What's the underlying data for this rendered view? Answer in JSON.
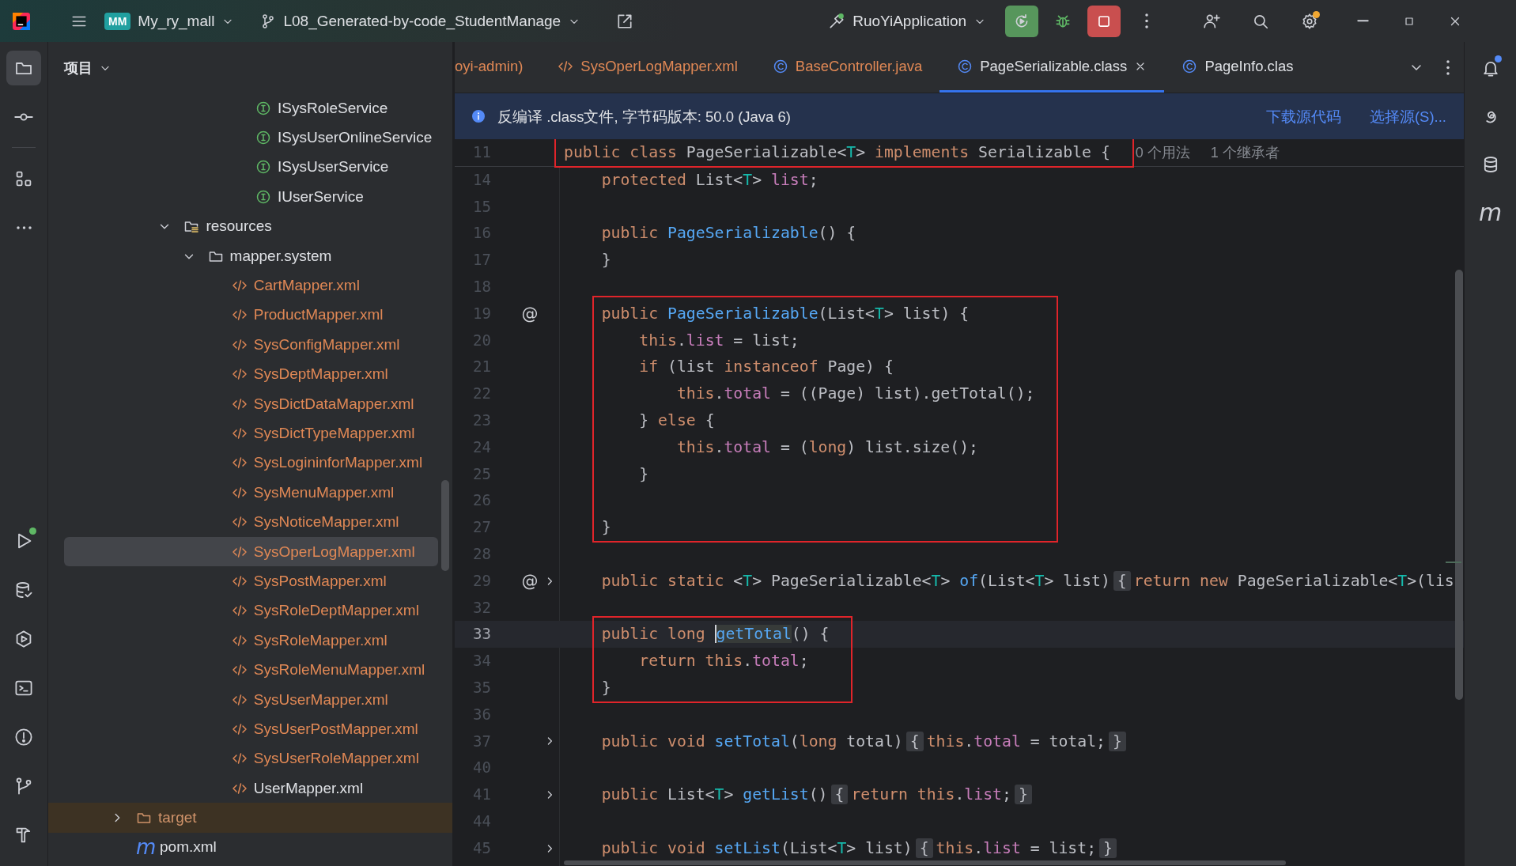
{
  "toolbar": {
    "project_badge": "MM",
    "project": "My_ry_mall",
    "branch": "L08_Generated-by-code_StudentManage",
    "run_configuration": "RuoYiApplication",
    "settings_badge": true
  },
  "left_strip": {
    "top": [
      {
        "kind": "project",
        "selected": true,
        "badge": false
      },
      {
        "kind": "commit",
        "selected": false,
        "badge": false
      },
      {
        "kind": "structure",
        "selected": false,
        "badge": false
      },
      {
        "kind": "more",
        "selected": false,
        "badge": false
      }
    ],
    "bottom": [
      {
        "kind": "run",
        "selected": false,
        "badge": true
      },
      {
        "kind": "database",
        "selected": false,
        "badge": false
      },
      {
        "kind": "services",
        "selected": false,
        "badge": false
      },
      {
        "kind": "terminal",
        "selected": false,
        "badge": false
      },
      {
        "kind": "problems",
        "selected": false,
        "badge": false
      },
      {
        "kind": "git",
        "selected": false,
        "badge": false
      },
      {
        "kind": "build",
        "selected": false,
        "badge": false
      }
    ]
  },
  "project_panel": {
    "title": "项目",
    "tree": [
      {
        "children": [
          {
            "children": [
              {
                "children": [
                  {
                    "children": [
                      {
                        "children": [
                          {
                            "label": "ISysRoleService",
                            "kind": "interface",
                            "color": "#dfe1e5",
                            "selected": false
                          },
                          {
                            "label": "ISysUserOnlineService",
                            "kind": "interface",
                            "color": "#dfe1e5",
                            "selected": false
                          },
                          {
                            "label": "ISysUserService",
                            "kind": "interface",
                            "color": "#dfe1e5",
                            "selected": false
                          },
                          {
                            "label": "IUserService",
                            "kind": "interface",
                            "color": "#dfe1e5",
                            "selected": false
                          }
                        ]
                      }
                    ]
                  }
                ]
              },
              {
                "label": "resources",
                "kind": "resource-folder",
                "color": "#dfe1e5",
                "selected": false,
                "expanded": true,
                "children": [
                  {
                    "label": "mapper.system",
                    "kind": "folder",
                    "color": "#dfe1e5",
                    "selected": false,
                    "expanded": true,
                    "children": [
                      {
                        "label": "CartMapper.xml",
                        "kind": "xml",
                        "color": "#e08855",
                        "selected": false
                      },
                      {
                        "label": "ProductMapper.xml",
                        "kind": "xml",
                        "color": "#e08855",
                        "selected": false
                      },
                      {
                        "label": "SysConfigMapper.xml",
                        "kind": "xml",
                        "color": "#e08855",
                        "selected": false
                      },
                      {
                        "label": "SysDeptMapper.xml",
                        "kind": "xml",
                        "color": "#e08855",
                        "selected": false
                      },
                      {
                        "label": "SysDictDataMapper.xml",
                        "kind": "xml",
                        "color": "#e08855",
                        "selected": false
                      },
                      {
                        "label": "SysDictTypeMapper.xml",
                        "kind": "xml",
                        "color": "#e08855",
                        "selected": false
                      },
                      {
                        "label": "SysLogininforMapper.xml",
                        "kind": "xml",
                        "color": "#e08855",
                        "selected": false
                      },
                      {
                        "label": "SysMenuMapper.xml",
                        "kind": "xml",
                        "color": "#e08855",
                        "selected": false
                      },
                      {
                        "label": "SysNoticeMapper.xml",
                        "kind": "xml",
                        "color": "#e08855",
                        "selected": false
                      },
                      {
                        "label": "SysOperLogMapper.xml",
                        "kind": "xml",
                        "color": "#e08855",
                        "selected": true
                      },
                      {
                        "label": "SysPostMapper.xml",
                        "kind": "xml",
                        "color": "#e08855",
                        "selected": false
                      },
                      {
                        "label": "SysRoleDeptMapper.xml",
                        "kind": "xml",
                        "color": "#e08855",
                        "selected": false
                      },
                      {
                        "label": "SysRoleMapper.xml",
                        "kind": "xml",
                        "color": "#e08855",
                        "selected": false
                      },
                      {
                        "label": "SysRoleMenuMapper.xml",
                        "kind": "xml",
                        "color": "#e08855",
                        "selected": false
                      },
                      {
                        "label": "SysUserMapper.xml",
                        "kind": "xml",
                        "color": "#e08855",
                        "selected": false
                      },
                      {
                        "label": "SysUserPostMapper.xml",
                        "kind": "xml",
                        "color": "#e08855",
                        "selected": false
                      },
                      {
                        "label": "SysUserRoleMapper.xml",
                        "kind": "xml",
                        "color": "#e08855",
                        "selected": false
                      },
                      {
                        "label": "UserMapper.xml",
                        "kind": "xml",
                        "color": "#dfe1e5",
                        "selected": false
                      }
                    ]
                  }
                ]
              }
            ]
          }
        ]
      },
      {
        "label": "target",
        "kind": "excluded-folder",
        "color": "#d0936a",
        "selected": false,
        "expanded": false
      },
      {
        "label": "pom.xml",
        "kind": "maven",
        "glyph": "m",
        "color": "#dfe1e5",
        "selected": false
      }
    ]
  },
  "editor": {
    "tabs": [
      {
        "label": "oyi-admin)",
        "kind": "none",
        "color": "#e08855",
        "selected": false
      },
      {
        "label": "SysOperLogMapper.xml",
        "kind": "xml",
        "color": "#e08855",
        "selected": false
      },
      {
        "label": "BaseController.java",
        "kind": "class",
        "color": "#e08855",
        "selected": false
      },
      {
        "label": "PageSerializable.class",
        "kind": "class",
        "color": "#dfe1e5",
        "selected": true
      },
      {
        "label": "PageInfo.clas",
        "kind": "class",
        "color": "#dfe1e5",
        "selected": false
      }
    ],
    "banner": {
      "message": "反编译 .class文件, 字节码版本: 50.0 (Java 6)",
      "links": [
        "下载源代码",
        "选择源(S)..."
      ]
    },
    "blocks": [
      {
        "kind": "sticky",
        "boxed": true,
        "lines": [
          {
            "number": "11",
            "folded": false,
            "current": false,
            "hints": [
              "0 个用法",
              "1 个继承者"
            ],
            "tokens": [
              {
                "kind": "kw",
                "text": "public class "
              },
              {
                "kind": "plain",
                "text": "PageSerializable<"
              },
              {
                "kind": "tparam",
                "text": "T"
              },
              {
                "kind": "plain",
                "text": "> "
              },
              {
                "kind": "kw",
                "text": "implements "
              },
              {
                "kind": "plain",
                "text": "Serializable {"
              }
            ]
          }
        ]
      },
      {
        "kind": "code",
        "boxed": false,
        "lines": [
          {
            "number": "14",
            "folded": false,
            "current": false,
            "tokens": [
              {
                "kind": "kw",
                "text": "    protected "
              },
              {
                "kind": "plain",
                "text": "List<"
              },
              {
                "kind": "tparam",
                "text": "T"
              },
              {
                "kind": "plain",
                "text": "> "
              },
              {
                "kind": "field",
                "text": "list"
              },
              {
                "kind": "plain",
                "text": ";"
              }
            ]
          },
          {
            "number": "15",
            "folded": false,
            "current": false
          },
          {
            "number": "16",
            "folded": false,
            "current": false,
            "tokens": [
              {
                "kind": "kw",
                "text": "    public "
              },
              {
                "kind": "fn",
                "text": "PageSerializable"
              },
              {
                "kind": "plain",
                "text": "() {"
              }
            ]
          },
          {
            "number": "17",
            "folded": false,
            "current": false,
            "tokens": [
              {
                "kind": "plain",
                "text": "    }"
              }
            ]
          },
          {
            "number": "18",
            "folded": false,
            "current": false
          }
        ]
      },
      {
        "kind": "code",
        "boxed": true,
        "lines": [
          {
            "number": "19",
            "gutter": "@",
            "folded": false,
            "current": false,
            "tokens": [
              {
                "kind": "kw",
                "text": "    public "
              },
              {
                "kind": "fn",
                "text": "PageSerializable"
              },
              {
                "kind": "plain",
                "text": "(List<"
              },
              {
                "kind": "tparam",
                "text": "T"
              },
              {
                "kind": "plain",
                "text": "> list) {"
              }
            ]
          },
          {
            "number": "20",
            "folded": false,
            "current": false,
            "tokens": [
              {
                "kind": "kw",
                "text": "        this"
              },
              {
                "kind": "member",
                "text": ".list"
              },
              {
                "kind": "plain",
                "text": " = list;"
              }
            ]
          },
          {
            "number": "21",
            "folded": false,
            "current": false,
            "tokens": [
              {
                "kind": "kw",
                "text": "        if "
              },
              {
                "kind": "plain",
                "text": "(list "
              },
              {
                "kind": "kw",
                "text": "instanceof "
              },
              {
                "kind": "plain",
                "text": "Page) {"
              }
            ]
          },
          {
            "number": "22",
            "folded": false,
            "current": false,
            "tokens": [
              {
                "kind": "kw",
                "text": "            this"
              },
              {
                "kind": "member",
                "text": ".total"
              },
              {
                "kind": "plain",
                "text": " = ((Page) list).getTotal();"
              }
            ]
          },
          {
            "number": "23",
            "folded": false,
            "current": false,
            "tokens": [
              {
                "kind": "plain",
                "text": "        } "
              },
              {
                "kind": "kw",
                "text": "else "
              },
              {
                "kind": "plain",
                "text": "{"
              }
            ]
          },
          {
            "number": "24",
            "folded": false,
            "current": false,
            "tokens": [
              {
                "kind": "kw",
                "text": "            this"
              },
              {
                "kind": "member",
                "text": ".total"
              },
              {
                "kind": "plain",
                "text": " = ("
              },
              {
                "kind": "kw",
                "text": "long"
              },
              {
                "kind": "plain",
                "text": ") list.size();"
              }
            ]
          },
          {
            "number": "25",
            "folded": false,
            "current": false,
            "tokens": [
              {
                "kind": "plain",
                "text": "        }"
              }
            ]
          },
          {
            "number": "26",
            "folded": false,
            "current": false
          },
          {
            "number": "27",
            "folded": false,
            "current": false,
            "tokens": [
              {
                "kind": "plain",
                "text": "    }"
              }
            ]
          }
        ]
      },
      {
        "kind": "code",
        "boxed": false,
        "lines": [
          {
            "number": "28",
            "folded": false,
            "current": false
          },
          {
            "number": "29",
            "gutter": "@",
            "folded": true,
            "current": false,
            "tokens": [
              {
                "kind": "kw",
                "text": "    public static "
              },
              {
                "kind": "plain",
                "text": "<"
              },
              {
                "kind": "tparam",
                "text": "T"
              },
              {
                "kind": "plain",
                "text": "> PageSerializable<"
              },
              {
                "kind": "tparam",
                "text": "T"
              },
              {
                "kind": "plain",
                "text": "> "
              },
              {
                "kind": "fn",
                "text": "of"
              },
              {
                "kind": "plain",
                "text": "(List<"
              },
              {
                "kind": "tparam",
                "text": "T"
              },
              {
                "kind": "plain",
                "text": "> list)"
              },
              {
                "kind": "fold",
                "text": "{"
              },
              {
                "kind": "kw",
                "text": "return new "
              },
              {
                "kind": "plain",
                "text": "PageSerializable<"
              },
              {
                "kind": "tparam",
                "text": "T"
              },
              {
                "kind": "plain",
                "text": ">(lis"
              }
            ]
          },
          {
            "number": "32",
            "folded": false,
            "current": false
          }
        ]
      },
      {
        "kind": "code",
        "boxed": true,
        "lines": [
          {
            "number": "33",
            "folded": false,
            "current": true,
            "tokens": [
              {
                "kind": "kw",
                "text": "    public long "
              },
              {
                "kind": "fn",
                "text": "getTotal",
                "caret": true
              },
              {
                "kind": "plain",
                "text": "() {"
              }
            ]
          },
          {
            "number": "34",
            "folded": false,
            "current": false,
            "tokens": [
              {
                "kind": "kw",
                "text": "        return this"
              },
              {
                "kind": "plain",
                "text": "."
              },
              {
                "kind": "field",
                "text": "total"
              },
              {
                "kind": "plain",
                "text": ";"
              }
            ]
          },
          {
            "number": "35",
            "folded": false,
            "current": false,
            "tokens": [
              {
                "kind": "plain",
                "text": "    }"
              }
            ]
          }
        ]
      },
      {
        "kind": "code",
        "boxed": false,
        "lines": [
          {
            "number": "36",
            "folded": false,
            "current": false
          },
          {
            "number": "37",
            "folded": true,
            "current": false,
            "tokens": [
              {
                "kind": "kw",
                "text": "    public void "
              },
              {
                "kind": "fn",
                "text": "setTotal"
              },
              {
                "kind": "plain",
                "text": "("
              },
              {
                "kind": "kw",
                "text": "long "
              },
              {
                "kind": "plain",
                "text": "total)"
              },
              {
                "kind": "fold",
                "text": "{"
              },
              {
                "kind": "kw",
                "text": "this"
              },
              {
                "kind": "plain",
                "text": "."
              },
              {
                "kind": "field",
                "text": "total"
              },
              {
                "kind": "plain",
                "text": " = total;"
              },
              {
                "kind": "fold",
                "text": "}"
              }
            ]
          },
          {
            "number": "40",
            "folded": false,
            "current": false
          },
          {
            "number": "41",
            "folded": true,
            "current": false,
            "tokens": [
              {
                "kind": "kw",
                "text": "    public "
              },
              {
                "kind": "plain",
                "text": "List<"
              },
              {
                "kind": "tparam",
                "text": "T"
              },
              {
                "kind": "plain",
                "text": "> "
              },
              {
                "kind": "fn",
                "text": "getList"
              },
              {
                "kind": "plain",
                "text": "()"
              },
              {
                "kind": "fold",
                "text": "{"
              },
              {
                "kind": "kw",
                "text": "return this"
              },
              {
                "kind": "plain",
                "text": "."
              },
              {
                "kind": "field",
                "text": "list"
              },
              {
                "kind": "plain",
                "text": ";"
              },
              {
                "kind": "fold",
                "text": "}"
              }
            ]
          },
          {
            "number": "44",
            "folded": false,
            "current": false
          },
          {
            "number": "45",
            "folded": true,
            "current": false,
            "tokens": [
              {
                "kind": "kw",
                "text": "    public void "
              },
              {
                "kind": "fn",
                "text": "setList"
              },
              {
                "kind": "plain",
                "text": "(List<"
              },
              {
                "kind": "tparam",
                "text": "T"
              },
              {
                "kind": "plain",
                "text": "> list)"
              },
              {
                "kind": "fold",
                "text": "{"
              },
              {
                "kind": "kw",
                "text": "this"
              },
              {
                "kind": "plain",
                "text": "."
              },
              {
                "kind": "field",
                "text": "list"
              },
              {
                "kind": "plain",
                "text": " = list;"
              },
              {
                "kind": "fold",
                "text": "}"
              }
            ]
          }
        ]
      }
    ]
  },
  "right_strip": [
    {
      "kind": "notifications",
      "badge": true
    },
    {
      "kind": "assistant",
      "badge": false
    },
    {
      "kind": "database",
      "badge": false
    },
    {
      "kind": "maven",
      "glyph": "m",
      "badge": false
    }
  ]
}
